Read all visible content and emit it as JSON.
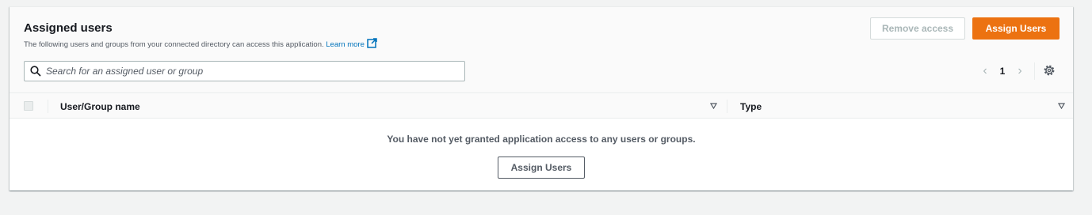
{
  "panel": {
    "title": "Assigned users",
    "description": "The following users and groups from your connected directory can access this application.",
    "learn_more": "Learn more"
  },
  "actions": {
    "remove_access": "Remove access",
    "assign_users": "Assign Users"
  },
  "search": {
    "placeholder": "Search for an assigned user or group",
    "value": ""
  },
  "pagination": {
    "current_page": "1",
    "prev_icon": "chevron-left-icon",
    "next_icon": "chevron-right-icon"
  },
  "table": {
    "columns": [
      "User/Group name",
      "Type"
    ],
    "empty_message": "You have not yet granted application access to any users or groups.",
    "empty_action": "Assign Users"
  },
  "colors": {
    "primary": "#ec7211",
    "link": "#0073bb",
    "background": "#f2f3f3"
  }
}
